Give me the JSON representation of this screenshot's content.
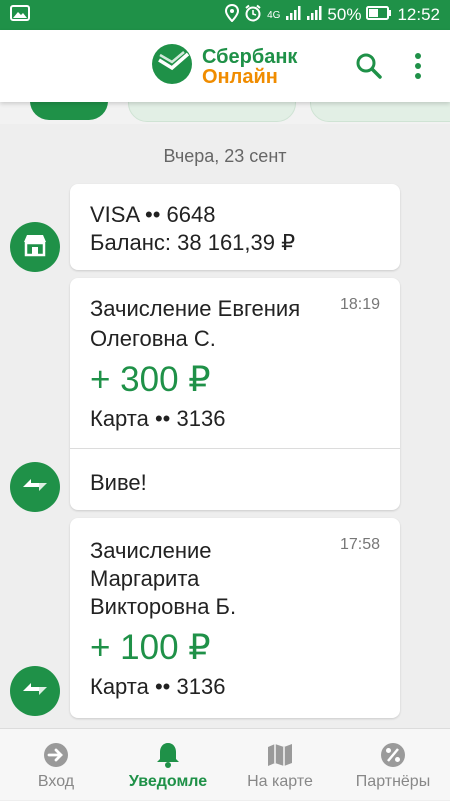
{
  "status_bar": {
    "network_label": "4G",
    "battery": "50%",
    "time": "12:52"
  },
  "app": {
    "logo_line1": "Сбербанк",
    "logo_line2": "Онлайн"
  },
  "feed": {
    "date_label": "Вчера, 23 сент",
    "messages": [
      {
        "line1": "VISA •• 6648",
        "line2": "Баланс: 38 161,39 ₽"
      },
      {
        "title_line1": "Зачисление Евгения",
        "title_line2": "Олеговна С.",
        "time": "18:19",
        "amount": "+ 300 ₽",
        "card": "Карта •• 3136",
        "comment": "Виве!"
      },
      {
        "title_line1": "Зачисление",
        "title_line2": "Маргарита",
        "title_line3": "Викторовна Б.",
        "time": "17:58",
        "amount": "+ 100 ₽",
        "card": "Карта •• 3136"
      }
    ]
  },
  "bottom_nav": [
    {
      "label": "Вход",
      "icon": "login-arrow-icon",
      "active": false
    },
    {
      "label": "Уведомле",
      "icon": "bell-icon",
      "active": true
    },
    {
      "label": "На карте",
      "icon": "map-icon",
      "active": false
    },
    {
      "label": "Партнёры",
      "icon": "percent-icon",
      "active": false
    }
  ],
  "colors": {
    "brand_green": "#1f9148",
    "brand_orange": "#f08c00"
  }
}
